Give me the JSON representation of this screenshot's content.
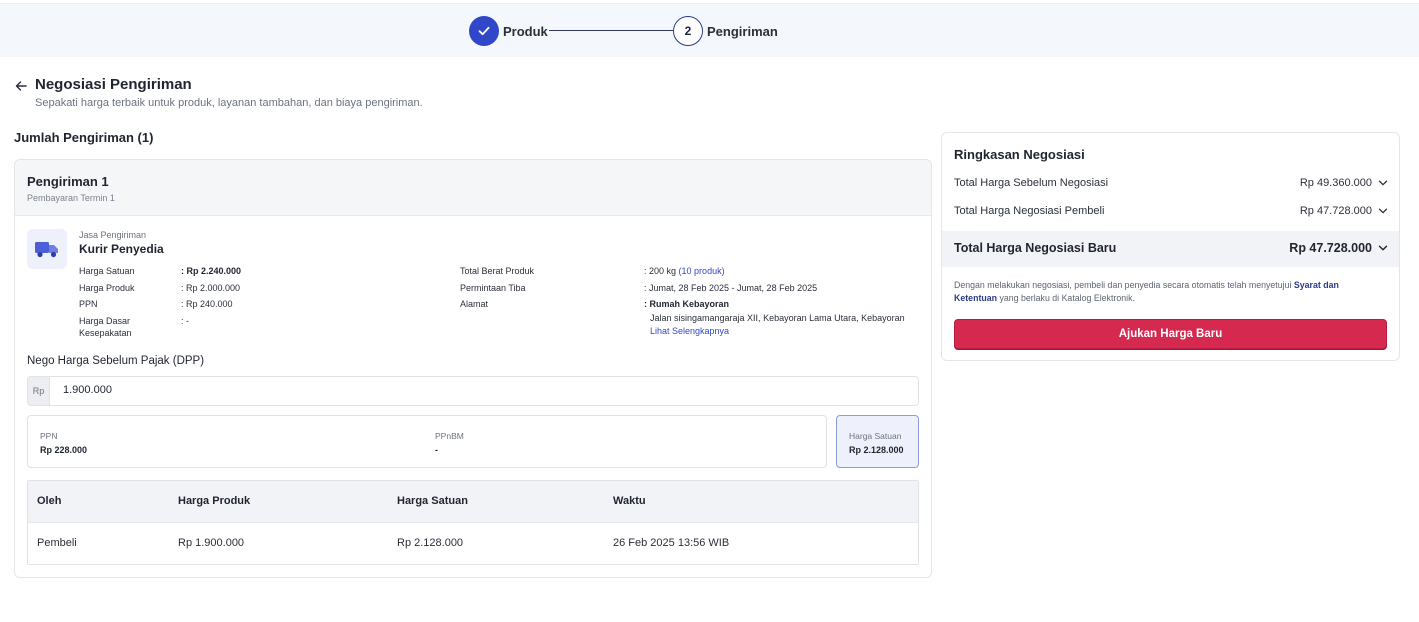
{
  "stepper": {
    "steps": [
      {
        "label": "Produk",
        "state": "done"
      },
      {
        "number": "2",
        "label": "Pengiriman",
        "state": "current"
      }
    ]
  },
  "header": {
    "title": "Negosiasi Pengiriman",
    "subtitle": "Sepakati harga terbaik untuk produk, layanan tambahan, dan biaya pengiriman."
  },
  "shipments_count_label": "Jumlah Pengiriman (1)",
  "shipment": {
    "title": "Pengiriman 1",
    "termin": "Pembayaran Termin 1",
    "jasa_label": "Jasa Pengiriman",
    "jasa_value": "Kurir Penyedia",
    "left_details": [
      {
        "label": "Harga Satuan",
        "value": ": Rp 2.240.000"
      },
      {
        "label": "Harga Produk",
        "value": ": Rp 2.000.000"
      },
      {
        "label": "PPN",
        "value": ": Rp 240.000"
      },
      {
        "label": "Harga Dasar Kesepakatan",
        "value": ": -"
      }
    ],
    "right_details": {
      "berat_label": "Total Berat Produk",
      "berat_value": ": 200 kg",
      "berat_link": "(10 produk)",
      "tiba_label": "Permintaan Tiba",
      "tiba_value": ": Jumat, 28 Feb 2025 - Jumat, 28 Feb 2025",
      "alamat_label": "Alamat",
      "alamat_name": ": Rumah Kebayoran",
      "alamat_detail": "Jalan sisingamangaraja XII, Kebayoran Lama Utara, Kebayoran",
      "alamat_link": "Lihat Selengkapnya"
    },
    "nego_label": "Nego Harga Sebelum Pajak (DPP)",
    "nego_prefix": "Rp",
    "nego_value": "1.900.000",
    "ppn_label": "PPN",
    "ppn_value": "Rp 228.000",
    "ppnbm_label": "PPnBM",
    "ppnbm_value": "-",
    "satuan_label": "Harga Satuan",
    "satuan_value": "Rp 2.128.000",
    "history": {
      "columns": [
        "Oleh",
        "Harga Produk",
        "Harga Satuan",
        "Waktu"
      ],
      "rows": [
        [
          "Pembeli",
          "Rp 1.900.000",
          "Rp 2.128.000",
          "26 Feb 2025 13:56 WIB"
        ]
      ]
    }
  },
  "summary": {
    "title": "Ringkasan Negosiasi",
    "rows": [
      {
        "label": "Total Harga Sebelum Negosiasi",
        "value": "Rp 49.360.000"
      },
      {
        "label": "Total Harga Negosiasi Pembeli",
        "value": "Rp 47.728.000"
      }
    ],
    "total_label": "Total Harga Negosiasi Baru",
    "total_value": "Rp 47.728.000",
    "disclaimer_pre": "Dengan melakukan negosiasi, pembeli dan penyedia secara otomatis telah menyetujui ",
    "disclaimer_link": "Syarat dan Ketentuan",
    "disclaimer_post": " yang berlaku di Katalog Elektronik.",
    "button_label": "Ajukan Harga Baru"
  },
  "colors": {
    "primary": "#2f47c8",
    "danger": "#d5294f",
    "stepper_bg": "#f4f7fb"
  }
}
